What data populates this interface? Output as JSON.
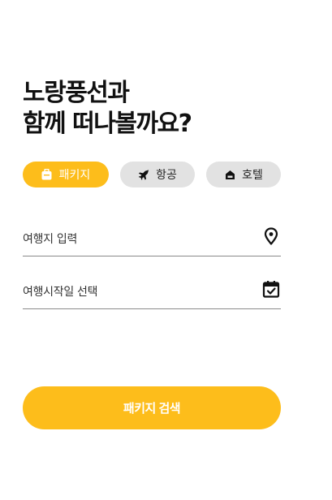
{
  "headline": {
    "line1": "노랑풍선과",
    "line2": "함께 떠나볼까요?"
  },
  "tabs": [
    {
      "label": "패키지",
      "icon": "suitcase-icon",
      "selected": true
    },
    {
      "label": "항공",
      "icon": "airplane-icon",
      "selected": false
    },
    {
      "label": "호텔",
      "icon": "hotel-icon",
      "selected": false
    }
  ],
  "fields": {
    "destination": {
      "placeholder": "여행지 입력",
      "icon": "location-pin-icon"
    },
    "start_date": {
      "placeholder": "여행시작일 선택",
      "icon": "calendar-check-icon"
    }
  },
  "search_button": {
    "label": "패키지 검색"
  },
  "colors": {
    "accent": "#fdbd1b",
    "inactive_tab": "#e2e2e2",
    "text": "#111111"
  }
}
